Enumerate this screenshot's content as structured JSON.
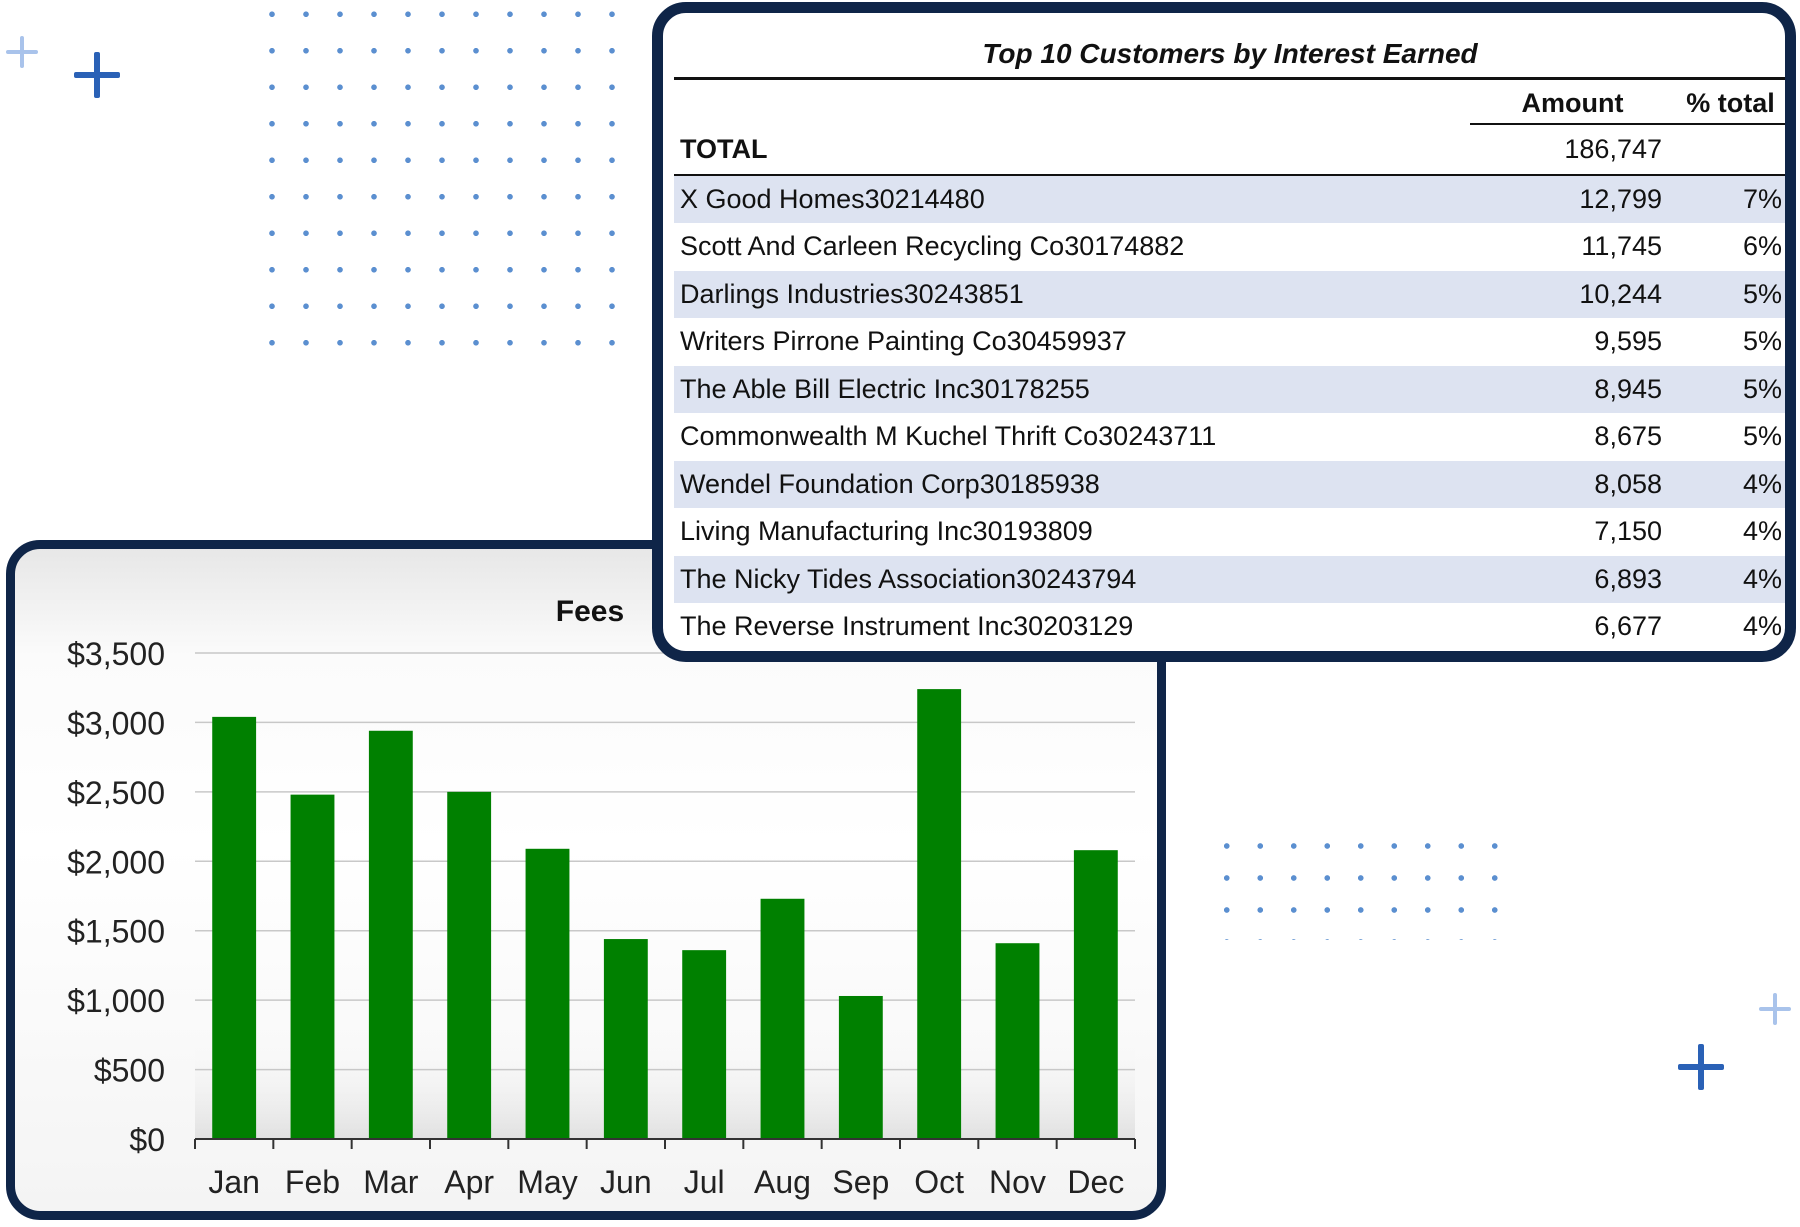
{
  "decor": {
    "accent": "#0f2548",
    "dot_color": "#5b8fd0",
    "plus_dark": "#2a61b6",
    "plus_light": "#a9c3eb",
    "icons": [
      "plus-icon",
      "dot-grid"
    ]
  },
  "table": {
    "title": "Top 10 Customers by Interest Earned",
    "headers": {
      "amount": "Amount",
      "pct": "% total"
    },
    "total": {
      "label": "TOTAL",
      "amount": "186,747",
      "pct": ""
    },
    "shade_color": "#dde3f1",
    "rows": [
      {
        "name": "X Good Homes30214480",
        "amount": "12,799",
        "pct": "7%"
      },
      {
        "name": "Scott And Carleen Recycling Co30174882",
        "amount": "11,745",
        "pct": "6%"
      },
      {
        "name": "Darlings Industries30243851",
        "amount": "10,244",
        "pct": "5%"
      },
      {
        "name": "Writers Pirrone Painting Co30459937",
        "amount": "9,595",
        "pct": "5%"
      },
      {
        "name": "The Able Bill Electric Inc30178255",
        "amount": "8,945",
        "pct": "5%"
      },
      {
        "name": "Commonwealth M Kuchel Thrift Co30243711",
        "amount": "8,675",
        "pct": "5%"
      },
      {
        "name": "Wendel Foundation Corp30185938",
        "amount": "8,058",
        "pct": "4%"
      },
      {
        "name": "Living Manufacturing Inc30193809",
        "amount": "7,150",
        "pct": "4%"
      },
      {
        "name": "The Nicky Tides Association30243794",
        "amount": "6,893",
        "pct": "4%"
      },
      {
        "name": "The Reverse Instrument Inc30203129",
        "amount": "6,677",
        "pct": "4%"
      }
    ]
  },
  "chart_data": {
    "type": "bar",
    "title": "Fees",
    "xlabel": "",
    "ylabel": "",
    "categories": [
      "Jan",
      "Feb",
      "Mar",
      "Apr",
      "May",
      "Jun",
      "Jul",
      "Aug",
      "Sep",
      "Oct",
      "Nov",
      "Dec"
    ],
    "values": [
      3040,
      2480,
      2940,
      2500,
      2090,
      1440,
      1360,
      1730,
      1030,
      3240,
      1410,
      2080
    ],
    "ylim": [
      0,
      3500
    ],
    "yticks": [
      0,
      500,
      1000,
      1500,
      2000,
      2500,
      3000,
      3500
    ],
    "ytick_labels": [
      "$0",
      "$500",
      "$1,000",
      "$1,500",
      "$2,000",
      "$2,500",
      "$3,000",
      "$3,500"
    ],
    "grid": true,
    "legend": "none",
    "bar_color": "#008000"
  }
}
